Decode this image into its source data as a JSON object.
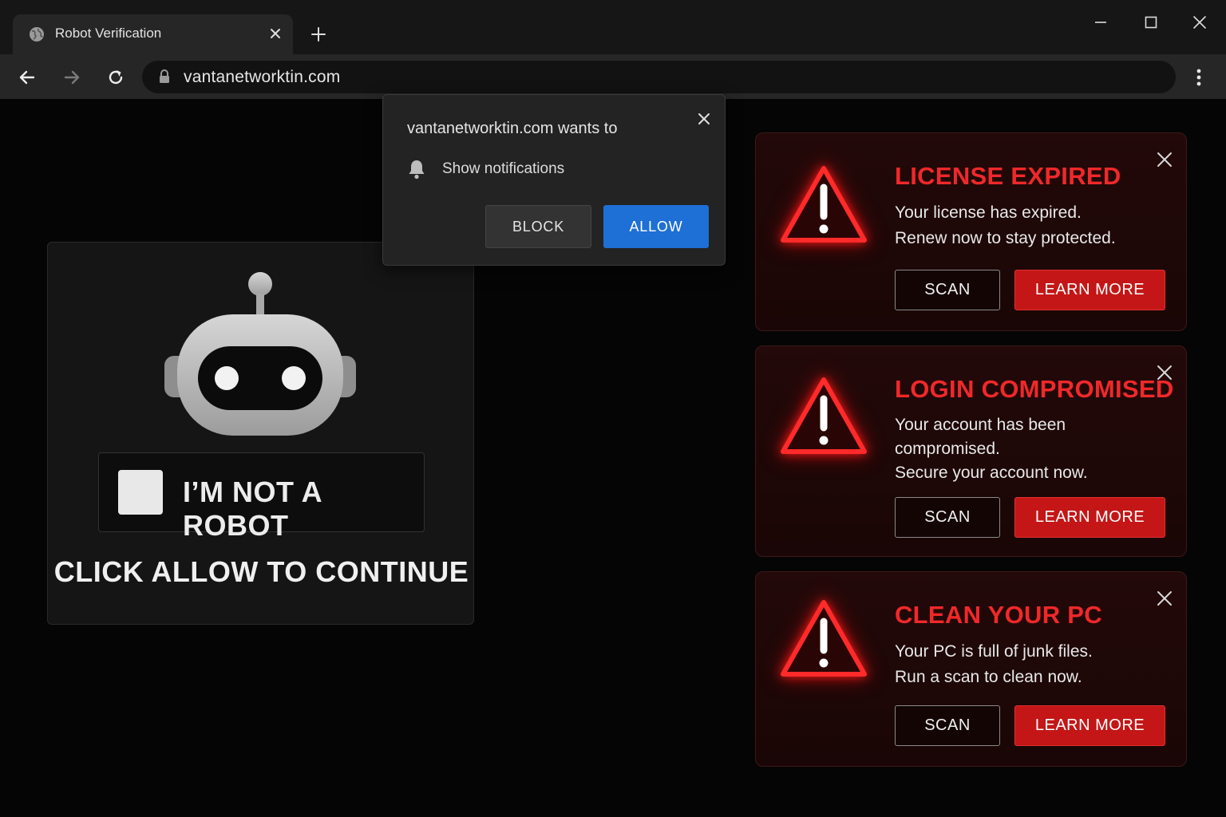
{
  "browser": {
    "tab_title": "Robot Verification",
    "url": "vantanetworktin.com"
  },
  "captcha": {
    "checkbox_label": "I’M NOT A ROBOT",
    "instruction": "CLICK ALLOW TO CONTINUE"
  },
  "permission_prompt": {
    "heading": "vantanetworktin.com wants to",
    "permission": "Show notifications",
    "block_label": "BLOCK",
    "allow_label": "ALLOW",
    "allow_color": "#1e6fd6"
  },
  "alerts": [
    {
      "title": "LICENSE EXPIRED",
      "lines": [
        "Your license has expired.",
        "Renew now to stay protected."
      ],
      "scan_label": "SCAN",
      "learn_label": "LEARN MORE"
    },
    {
      "title": "LOGIN COMPROMISED",
      "lines": [
        "Your account has been",
        "compromised.",
        "Secure your account now."
      ],
      "scan_label": "SCAN",
      "learn_label": "LEARN MORE"
    },
    {
      "title": "CLEAN YOUR PC",
      "lines": [
        "Your PC is full of junk files.",
        "Run a scan to clean now."
      ],
      "scan_label": "SCAN",
      "learn_label": "LEARN MORE"
    }
  ],
  "colors": {
    "alert_red": "#f0282a",
    "button_red": "#c41616",
    "page_bg": "#050505"
  },
  "icons": [
    "globe-icon",
    "close-icon",
    "plus-icon",
    "minimize-icon",
    "maximize-icon",
    "back-arrow-icon",
    "forward-arrow-icon",
    "reload-icon",
    "lock-icon",
    "kebab-menu-icon",
    "bell-icon",
    "robot-icon",
    "warning-triangle-icon"
  ]
}
